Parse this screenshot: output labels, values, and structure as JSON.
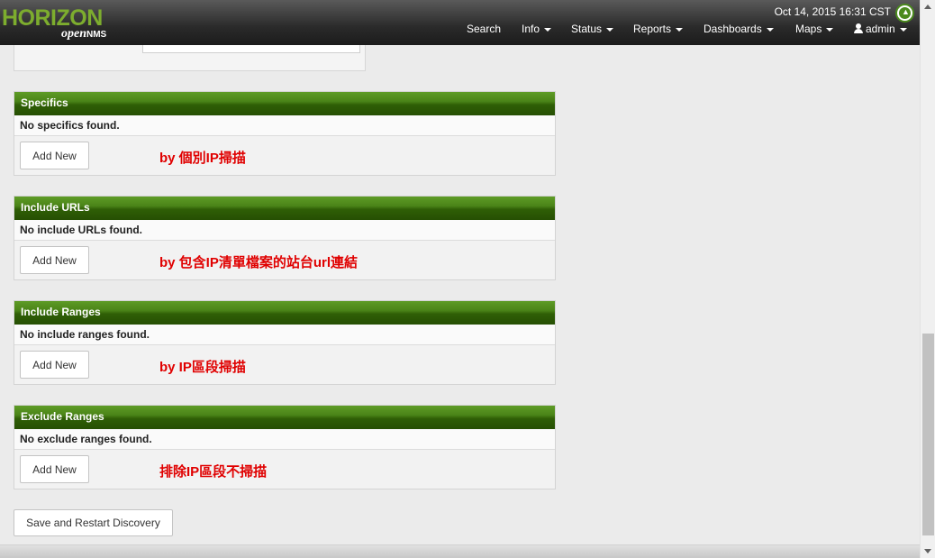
{
  "header": {
    "logo_main": "HORIZON",
    "logo_sub": "open",
    "logo_sub_bold": "NMS",
    "datetime": "Oct 14, 2015 16:31 CST",
    "nav": [
      {
        "label": "Search",
        "dropdown": false
      },
      {
        "label": "Info",
        "dropdown": true
      },
      {
        "label": "Status",
        "dropdown": true
      },
      {
        "label": "Reports",
        "dropdown": true
      },
      {
        "label": "Dashboards",
        "dropdown": true
      },
      {
        "label": "Maps",
        "dropdown": true
      }
    ],
    "user": {
      "label": "admin",
      "icon": "user-icon"
    },
    "notification_icon": "bell-icon"
  },
  "panels": [
    {
      "title": "Specifics",
      "message": "No specifics found.",
      "button": "Add New",
      "note": "by 個別IP掃描"
    },
    {
      "title": "Include URLs",
      "message": "No include URLs found.",
      "button": "Add New",
      "note": "by 包含IP清單檔案的站台url連結"
    },
    {
      "title": "Include Ranges",
      "message": "No include ranges found.",
      "button": "Add New",
      "note": "by IP區段掃描"
    },
    {
      "title": "Exclude Ranges",
      "message": "No exclude ranges found.",
      "button": "Add New",
      "note": "排除IP區段不掃描"
    }
  ],
  "save_button": "Save and Restart Discovery",
  "colors": {
    "panel_header": "#3d7210",
    "note_text": "#e00000",
    "navbar": "#2a2a2a",
    "logo_green": "#7dad2e"
  }
}
